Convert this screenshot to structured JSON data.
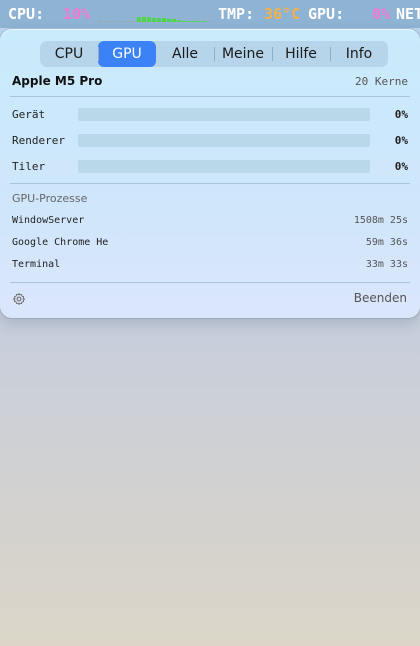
{
  "menubar": {
    "cpu_label": "CPU:",
    "cpu_value": "10%",
    "tmp_label": "TMP:",
    "tmp_value": "36°C",
    "gpu_label": "GPU:",
    "gpu_value": "0%",
    "net_label": "NET",
    "cpu_history": [
      0.35,
      0.35,
      0.35,
      0.3,
      0.3,
      0.25,
      0.2,
      0.2,
      0.15,
      0.1,
      0.1,
      0.1,
      0.05,
      0.05
    ]
  },
  "tabs": [
    {
      "label": "CPU",
      "active": false
    },
    {
      "label": "GPU",
      "active": true
    },
    {
      "label": "Alle",
      "active": false
    },
    {
      "label": "Meine",
      "active": false
    },
    {
      "label": "Hilfe",
      "active": false
    },
    {
      "label": "Info",
      "active": false
    }
  ],
  "device": {
    "name": "Apple M5 Pro",
    "cores": "20 Kerne"
  },
  "metrics": [
    {
      "label": "Gerät",
      "value": "0%",
      "fraction": 0
    },
    {
      "label": "Renderer",
      "value": "0%",
      "fraction": 0
    },
    {
      "label": "Tiler",
      "value": "0%",
      "fraction": 0
    }
  ],
  "processes": {
    "title": "GPU-Prozesse",
    "items": [
      {
        "name": "WindowServer",
        "time": "1508m 25s"
      },
      {
        "name": "Google Chrome He",
        "time": "59m 36s"
      },
      {
        "name": "Terminal",
        "time": "33m 33s"
      }
    ]
  },
  "footer": {
    "settings_icon": "gear-icon",
    "quit_label": "Beenden"
  },
  "colors": {
    "accent": "#3b82f6",
    "menubar": "#8fb3d3",
    "pink": "#f07bd0",
    "orange": "#f2b24a",
    "graph": "#4fd64a"
  }
}
